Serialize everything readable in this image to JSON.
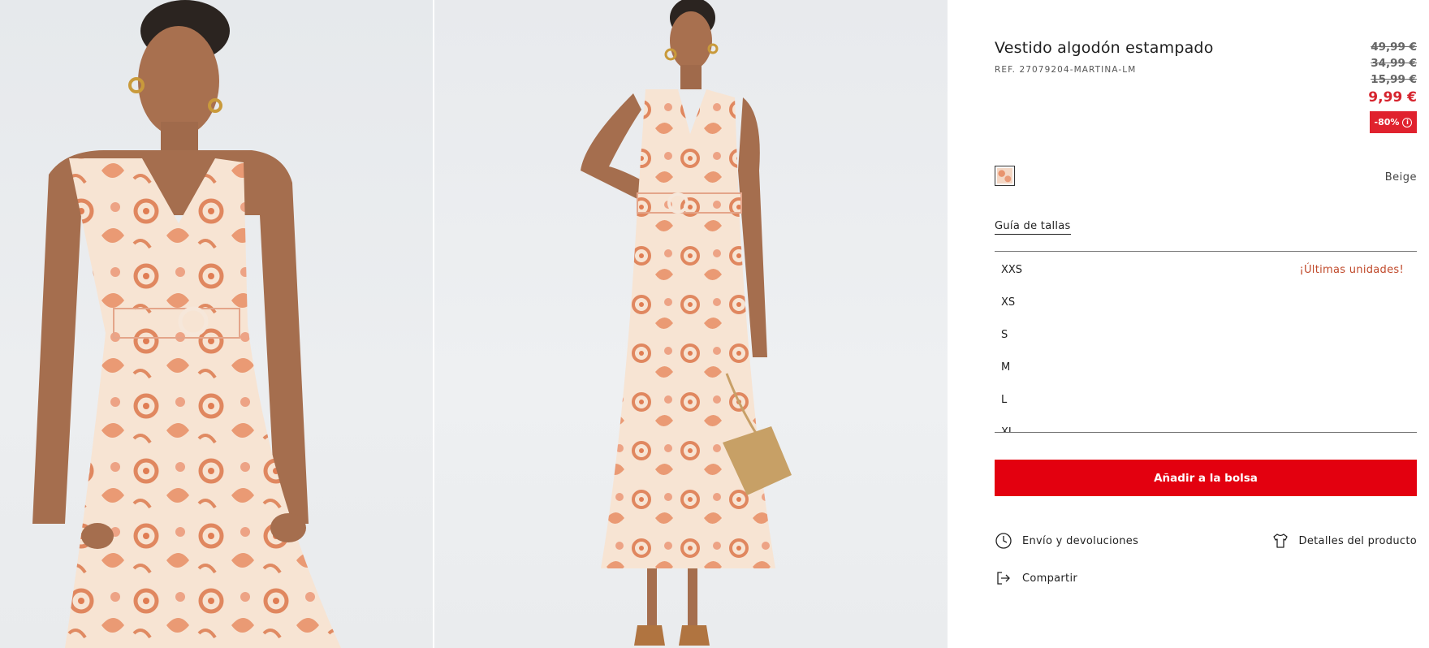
{
  "product": {
    "title": "Vestido algodón estampado",
    "ref": "REF. 27079204-MARTINA-LM",
    "prices": {
      "old": [
        "49,99 €",
        "34,99 €",
        "15,99 €"
      ],
      "current": "9,99 €",
      "discount": "-80%"
    },
    "color": {
      "name": "Beige",
      "swatch_colors": [
        "#f3d7c5",
        "#e8936d"
      ]
    },
    "size_guide_label": "Guía de tallas",
    "sizes": [
      {
        "label": "XXS",
        "note": "¡Últimas unidades!"
      },
      {
        "label": "XS",
        "note": ""
      },
      {
        "label": "S",
        "note": ""
      },
      {
        "label": "M",
        "note": ""
      },
      {
        "label": "L",
        "note": ""
      },
      {
        "label": "XL",
        "note": ""
      }
    ],
    "add_to_bag_label": "Añadir a la bolsa",
    "links": {
      "shipping": "Envío y devoluciones",
      "details": "Detalles del producto",
      "share": "Compartir"
    }
  },
  "colors": {
    "accent_red": "#e3000f",
    "price_red": "#d6232d",
    "low_stock": "#c0492a"
  }
}
